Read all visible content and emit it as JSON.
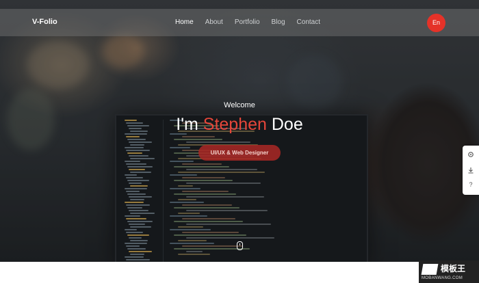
{
  "header": {
    "brand": "V-Folio",
    "nav": [
      "Home",
      "About",
      "Portfolio",
      "Blog",
      "Contact"
    ],
    "active_nav": "Home",
    "language_button": "En"
  },
  "hero": {
    "welcome": "Welcome",
    "headline_prefix": "I'm",
    "name": "Stephen",
    "surname": "Doe",
    "role_button": "UI/UX & Web Designer"
  },
  "side_widget": {
    "icons": [
      "settings-icon",
      "download-icon",
      "help-icon"
    ]
  },
  "watermark": {
    "text_cn": "模板王",
    "text_en": "MOBANWANG.COM"
  },
  "colors": {
    "accent": "#e5463a",
    "lang_button": "#e53228",
    "role_button": "#aa2824"
  }
}
